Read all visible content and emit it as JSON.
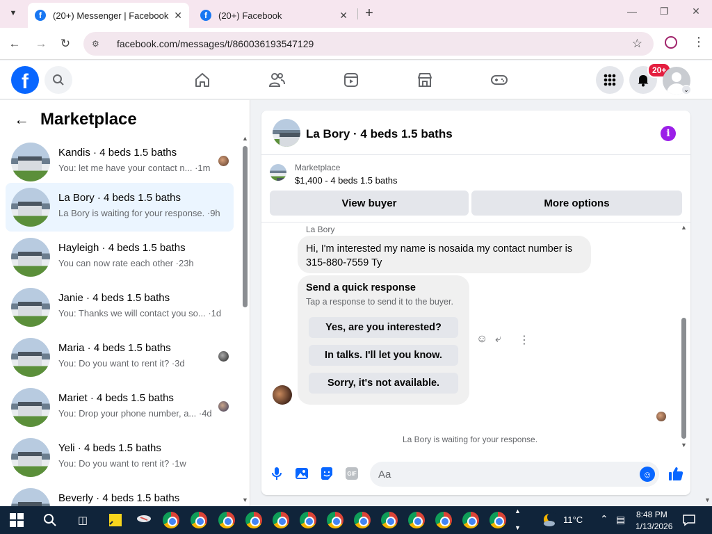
{
  "browser": {
    "tabs": [
      {
        "title": "(20+) Messenger | Facebook",
        "active": true
      },
      {
        "title": "(20+) Facebook",
        "active": false
      }
    ],
    "url": "facebook.com/messages/t/860036193547129",
    "icons": {
      "back": "back-arrow-icon",
      "forward": "forward-arrow-icon",
      "reload": "reload-icon",
      "star": "bookmark-star-icon"
    }
  },
  "fb_nav": {
    "notification_badge": "20+",
    "icons": [
      "home-icon",
      "friends-icon",
      "video-icon",
      "marketplace-icon",
      "gaming-icon"
    ]
  },
  "sidebar": {
    "title": "Marketplace",
    "conversations": [
      {
        "name": "Kandis · 4 beds 1.5 baths",
        "preview": "You: let me have your contact n... ·1m",
        "selected": false,
        "has_avatar": true
      },
      {
        "name": "La Bory · 4 beds 1.5 baths",
        "preview": "La Bory is waiting for your response. ·9h",
        "selected": true,
        "has_avatar": false
      },
      {
        "name": "Hayleigh · 4 beds 1.5 baths",
        "preview": "You can now rate each other ·23h",
        "selected": false,
        "has_avatar": false
      },
      {
        "name": "Janie · 4 beds 1.5 baths",
        "preview": "You: Thanks we will contact you so...  ·1d",
        "selected": false,
        "has_avatar": false
      },
      {
        "name": "Maria · 4 beds 1.5 baths",
        "preview": "You: Do you want to rent it? ·3d",
        "selected": false,
        "has_avatar": true
      },
      {
        "name": "Mariet · 4 beds 1.5 baths",
        "preview": "You: Drop your phone number, a... ·4d",
        "selected": false,
        "has_avatar": true
      },
      {
        "name": "Yeli · 4 beds 1.5 baths",
        "preview": "You: Do you want to rent it? ·1w",
        "selected": false,
        "has_avatar": false
      },
      {
        "name": "Beverly · 4 beds 1.5 baths",
        "preview": "",
        "selected": false,
        "has_avatar": false
      }
    ]
  },
  "chat": {
    "title": "La Bory · 4 beds 1.5 baths",
    "listing_category": "Marketplace",
    "listing_price": "$1,400 - 4 beds 1.5 baths",
    "view_buyer_label": "View buyer",
    "more_options_label": "More options",
    "sender_name": "La Bory",
    "message_line1": "Hi, I'm interested my name is nosaida my contact number is",
    "message_line2": "315-880-7559 Ty",
    "quick_response_title": "Send a quick response",
    "quick_response_sub": "Tap a response to send it to the buyer.",
    "quick_responses": [
      "Yes, are you interested?",
      "In talks. I'll let you know.",
      "Sorry, it's not available."
    ],
    "waiting_text": "La Bory is waiting for your response.",
    "composer_placeholder": "Aa"
  },
  "taskbar": {
    "temperature": "11°C",
    "time": "8:48 PM",
    "date": "1/13/2026"
  }
}
